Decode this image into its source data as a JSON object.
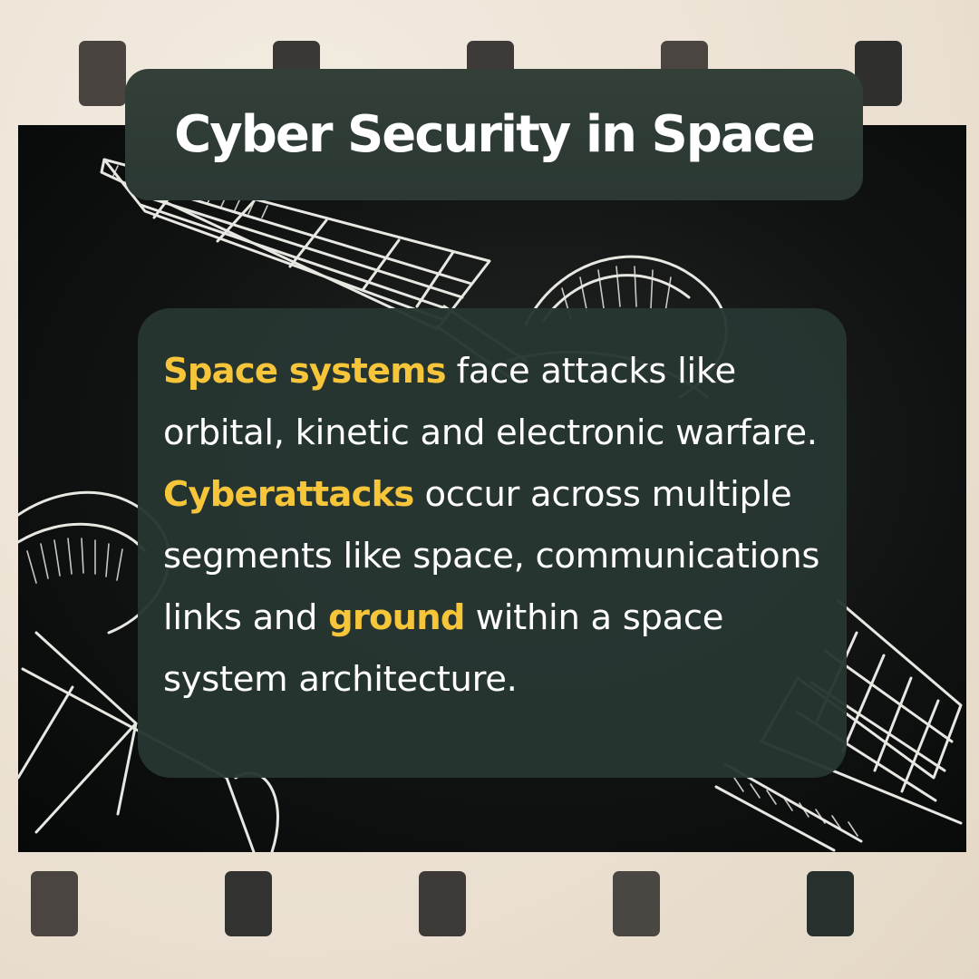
{
  "title": "Cyber Security in Space",
  "body": {
    "hl1": "Space systems",
    "t1": " face attacks like orbital, kinetic and electronic warfare. ",
    "hl2": "Cyberattacks",
    "t2": " occur across multiple segments like space, communications links and ",
    "hl3": "ground",
    "t3": " within a space system architecture."
  },
  "colors": {
    "highlight": "#f6c53a",
    "panel": "#2b3833",
    "text": "#ffffff",
    "film": "#101312",
    "paper": "#ece2d4"
  },
  "illustration": "satellite-sketch-icon"
}
